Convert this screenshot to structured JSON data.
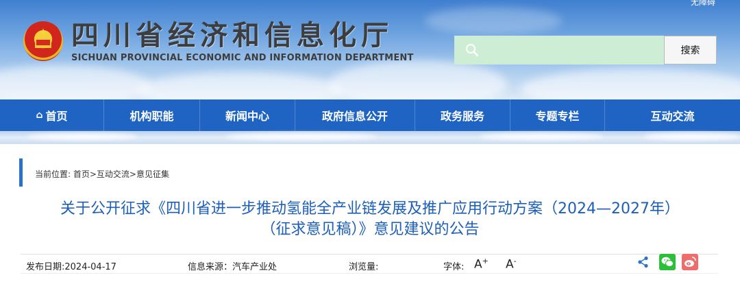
{
  "header": {
    "accessibility_label": "无障碍",
    "title_cn": "四川省经济和信息化厅",
    "title_en": "SICHUAN PROVINCIAL ECONOMIC AND INFORMATION DEPARTMENT",
    "search_placeholder": "",
    "search_button_label": "搜索"
  },
  "nav": {
    "items": [
      {
        "label": "首页",
        "icon": "home-icon"
      },
      {
        "label": "机构职能"
      },
      {
        "label": "新闻中心"
      },
      {
        "label": "政府信息公开"
      },
      {
        "label": "政务服务"
      },
      {
        "label": "专题专栏"
      },
      {
        "label": "互动交流"
      }
    ]
  },
  "article": {
    "breadcrumb": "当前位置: 首页>互动交流>意见征集",
    "title_line1": "关于公开征求《四川省进一步推动氢能全产业链发展及推广应用行动方案（2024—2027年）",
    "title_line2": "（征求意见稿）》意见建议的公告",
    "publish_date": "发布日期:2024-04-17",
    "source": "信息来源：汽车产业处",
    "views": "浏览量:",
    "font_label": "字体:",
    "font_increase": "A",
    "font_increase_mark": "+",
    "font_decrease": "A",
    "font_decrease_mark": "-"
  },
  "colors": {
    "nav_bg": "#1f64c2",
    "title_blue": "#1d5fb8",
    "search_bg": "#cdeed5",
    "wechat": "#2dbf3a",
    "weibo": "#ef6c6c"
  }
}
